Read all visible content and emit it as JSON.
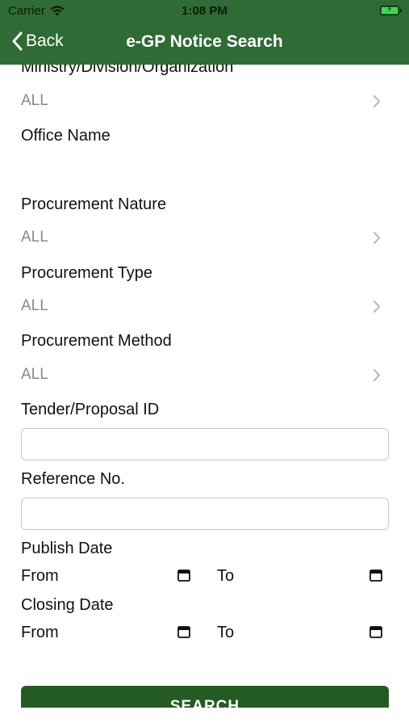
{
  "status_bar": {
    "carrier": "Carrier",
    "time": "1:08 PM"
  },
  "nav": {
    "back_label": "Back",
    "title": "e-GP Notice Search"
  },
  "form": {
    "ministry": {
      "label": "Ministry/Division/Organization",
      "value": "ALL"
    },
    "office": {
      "label": "Office Name"
    },
    "nature": {
      "label": "Procurement Nature",
      "value": "ALL"
    },
    "type": {
      "label": "Procurement Type",
      "value": "ALL"
    },
    "method": {
      "label": "Procurement Method",
      "value": "ALL"
    },
    "tender_id": {
      "label": "Tender/Proposal ID",
      "value": ""
    },
    "reference": {
      "label": "Reference No.",
      "value": ""
    },
    "publish_date": {
      "label": "Publish Date",
      "from_label": "From",
      "to_label": "To"
    },
    "closing_date": {
      "label": "Closing Date",
      "from_label": "From",
      "to_label": "To"
    },
    "search_label": "SEARCH"
  },
  "colors": {
    "header_green": "#2f6b34",
    "button_green": "#245b22",
    "placeholder_gray": "#8a8a8a"
  },
  "icons": {
    "chevron": "chevron-right-icon",
    "calendar": "calendar-icon",
    "back": "chevron-left-icon",
    "wifi": "wifi-icon",
    "battery": "battery-charging-icon"
  }
}
